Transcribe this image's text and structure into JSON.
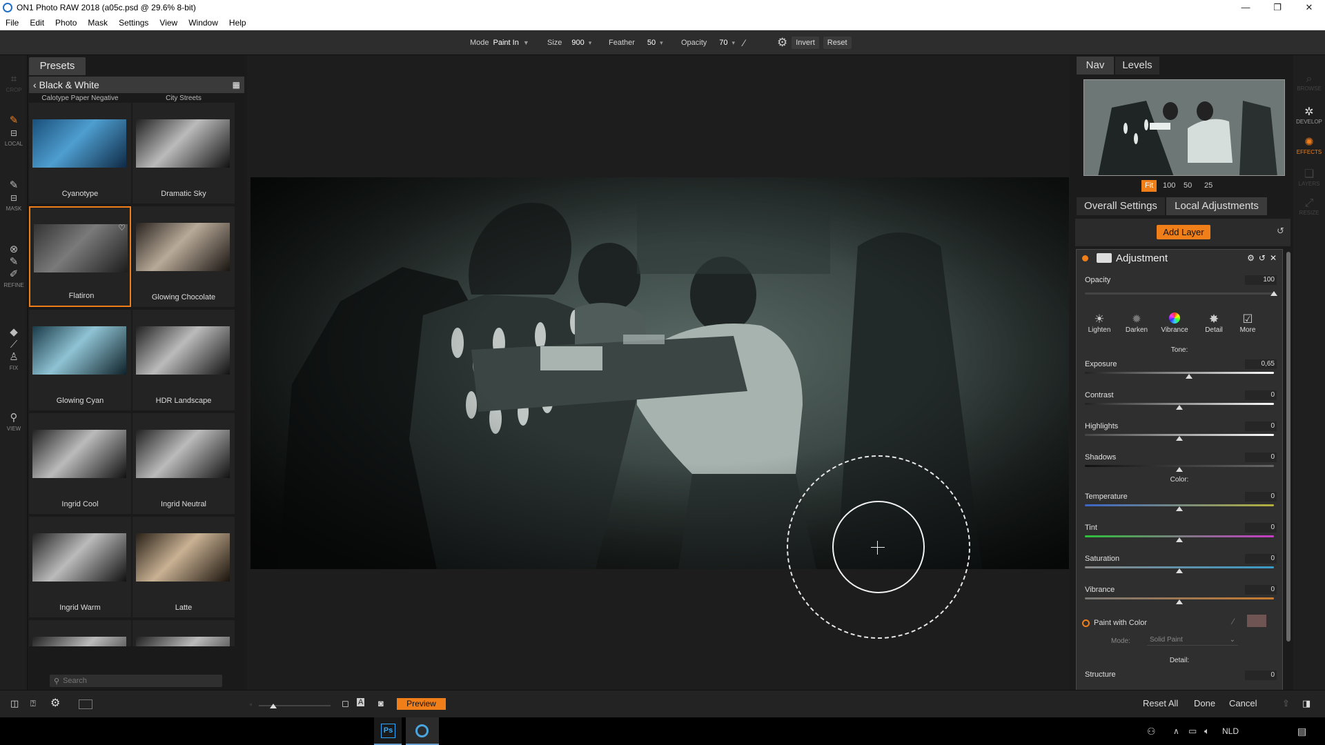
{
  "window": {
    "title": "ON1 Photo RAW 2018 (a05c.psd @ 29.6% 8-bit)",
    "controls": [
      "—",
      "❐",
      "✕"
    ]
  },
  "menu": [
    "File",
    "Edit",
    "Photo",
    "Mask",
    "Settings",
    "View",
    "Window",
    "Help"
  ],
  "options": {
    "mode_label": "Mode",
    "mode_value": "Paint In",
    "size_label": "Size",
    "size_value": "900",
    "feather_label": "Feather",
    "feather_value": "50",
    "opacity_label": "Opacity",
    "opacity_value": "70",
    "invert_label": "Invert",
    "reset_label": "Reset"
  },
  "tools": [
    {
      "label": "CROP",
      "icon": "crop-icon"
    },
    {
      "label": "LOCAL",
      "icon": "local-brush-icon"
    },
    {
      "label": "MASK",
      "icon": "mask-brush-icon"
    },
    {
      "label": "REFINE",
      "icon": "refine-icon"
    },
    {
      "label": "FIX",
      "icon": "fix-icon"
    },
    {
      "label": "VIEW",
      "icon": "zoom-icon"
    }
  ],
  "presets": {
    "tab_label": "Presets",
    "category": "Black & White",
    "partial_top": [
      "Calotype Paper Negative",
      "City Streets"
    ],
    "items": [
      {
        "name": "Cyanotype",
        "tone": "blue"
      },
      {
        "name": "Dramatic Sky",
        "tone": "bw"
      },
      {
        "name": "Flatiron",
        "tone": "flat",
        "selected": true
      },
      {
        "name": "Glowing Chocolate",
        "tone": "warm"
      },
      {
        "name": "Glowing Cyan",
        "tone": "cyan"
      },
      {
        "name": "HDR Landscape",
        "tone": "bw"
      },
      {
        "name": "Ingrid Cool",
        "tone": "bw"
      },
      {
        "name": "Ingrid Neutral",
        "tone": "bw"
      },
      {
        "name": "Ingrid Warm",
        "tone": "bw"
      },
      {
        "name": "Latte",
        "tone": "latte"
      }
    ],
    "search_placeholder": "Search"
  },
  "right": {
    "nav_tab": "Nav",
    "levels_tab": "Levels",
    "zoom": [
      "Fit",
      "100",
      "50",
      "25"
    ],
    "overall_tab": "Overall Settings",
    "local_tab": "Local Adjustments",
    "add_layer": "Add Layer",
    "adjustment": {
      "title": "Adjustment",
      "opacity_label": "Opacity",
      "opacity_value": "100",
      "filters": [
        {
          "label": "Lighten",
          "icon": "lighten-icon"
        },
        {
          "label": "Darken",
          "icon": "darken-icon"
        },
        {
          "label": "Vibrance",
          "icon": "vibrance-icon"
        },
        {
          "label": "Detail",
          "icon": "detail-icon"
        },
        {
          "label": "More",
          "icon": "more-icon"
        }
      ],
      "tone_title": "Tone:",
      "tone_sliders": [
        {
          "label": "Exposure",
          "value": "0,65",
          "pos": 0.55
        },
        {
          "label": "Contrast",
          "value": "0",
          "pos": 0.5
        },
        {
          "label": "Highlights",
          "value": "0",
          "pos": 0.5
        },
        {
          "label": "Shadows",
          "value": "0",
          "pos": 0.5
        }
      ],
      "color_title": "Color:",
      "color_sliders": [
        {
          "label": "Temperature",
          "value": "0",
          "pos": 0.5
        },
        {
          "label": "Tint",
          "value": "0",
          "pos": 0.5
        },
        {
          "label": "Saturation",
          "value": "0",
          "pos": 0.5
        },
        {
          "label": "Vibrance",
          "value": "0",
          "pos": 0.5
        }
      ],
      "paint_with_color": "Paint with Color",
      "mode_label": "Mode:",
      "mode_value": "Solid Paint",
      "detail_title": "Detail:",
      "structure_label": "Structure",
      "structure_value": "0"
    }
  },
  "modules": [
    {
      "label": "BROWSE",
      "icon": "browse-icon",
      "state": "dim"
    },
    {
      "label": "DEVELOP",
      "icon": "develop-icon",
      "state": "normal"
    },
    {
      "label": "EFFECTS",
      "icon": "effects-icon",
      "state": "active"
    },
    {
      "label": "LAYERS",
      "icon": "layers-icon",
      "state": "dim"
    },
    {
      "label": "RESIZE",
      "icon": "resize-icon",
      "state": "dim"
    }
  ],
  "bottom": {
    "preview": "Preview",
    "reset_all": "Reset All",
    "done": "Done",
    "cancel": "Cancel",
    "zoom_level": 0.2
  },
  "taskbar": {
    "language": "NLD"
  },
  "colors": {
    "accent": "#f07f1a"
  }
}
